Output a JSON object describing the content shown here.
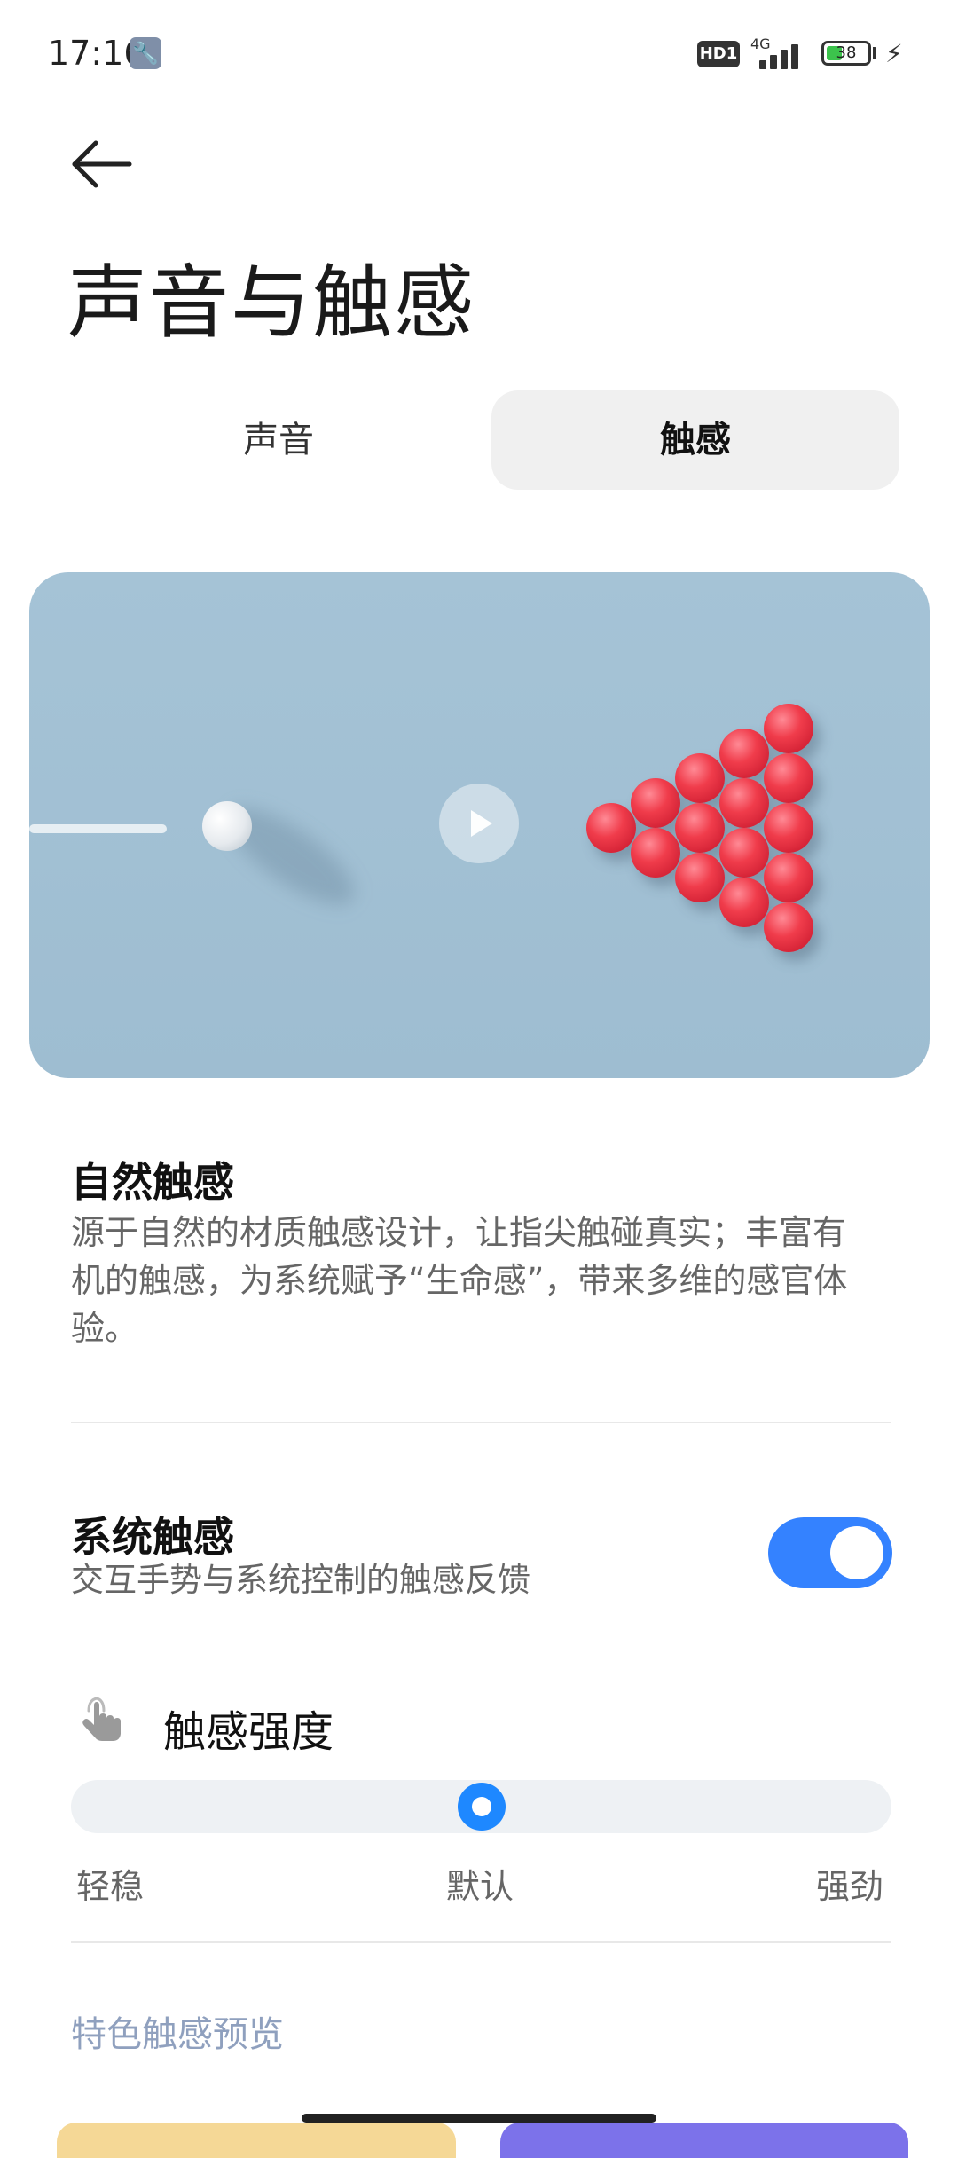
{
  "status_bar": {
    "time": "17:16",
    "hd_badge": "HD1",
    "network": "4G",
    "battery": "38",
    "battery_level": 0.38
  },
  "header": {
    "title": "声音与触感"
  },
  "tabs": [
    {
      "label": "声音",
      "selected": false
    },
    {
      "label": "触感",
      "selected": true
    }
  ],
  "hero": {
    "play_icon": "play-icon"
  },
  "natural_haptics": {
    "title": "自然触感",
    "description": "源于自然的材质触感设计，让指尖触碰真实；丰富有机的触感，为系统赋予“生命感”，带来多维的感官体验。"
  },
  "system_haptics": {
    "title": "系统触感",
    "subtitle": "交互手势与系统控制的触感反馈",
    "enabled": true
  },
  "strength": {
    "label": "触感强度",
    "icon": "hand-touch-icon",
    "min_label": "轻稳",
    "mid_label": "默认",
    "max_label": "强劲",
    "level": 0.5
  },
  "preview": {
    "label": "特色触感预览"
  },
  "colors": {
    "accent": "#3482ff",
    "preview_label": "#8fa0be",
    "card_yellow": "#f5d896",
    "card_purple": "#7c72ea"
  }
}
